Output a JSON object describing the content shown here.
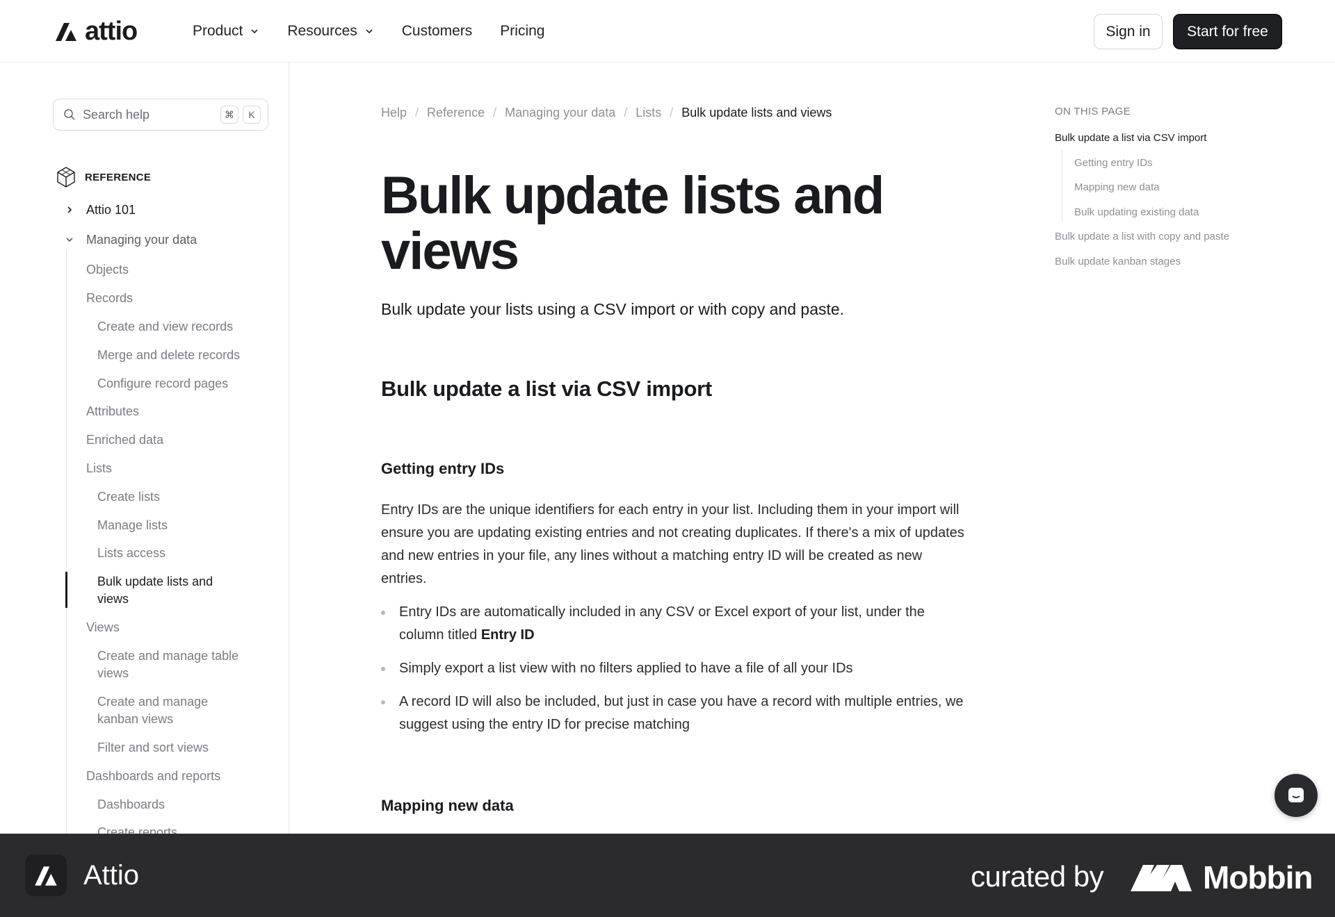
{
  "header": {
    "brand": "attio",
    "nav": [
      {
        "label": "Product",
        "dropdown": true
      },
      {
        "label": "Resources",
        "dropdown": true
      },
      {
        "label": "Customers",
        "dropdown": false
      },
      {
        "label": "Pricing",
        "dropdown": false
      }
    ],
    "signin_label": "Sign in",
    "start_label": "Start for free"
  },
  "sidebar": {
    "search_placeholder": "Search help",
    "kbd_cmd": "⌘",
    "kbd_k": "K",
    "section_label": "REFERENCE",
    "items": [
      {
        "label": "Attio 101"
      },
      {
        "label": "Managing your data"
      },
      {
        "label": "Objects"
      },
      {
        "label": "Records"
      },
      {
        "label": "Create and view records"
      },
      {
        "label": "Merge and delete records"
      },
      {
        "label": "Configure record pages"
      },
      {
        "label": "Attributes"
      },
      {
        "label": "Enriched data"
      },
      {
        "label": "Lists"
      },
      {
        "label": "Create lists"
      },
      {
        "label": "Manage lists"
      },
      {
        "label": "Lists access"
      },
      {
        "label": "Bulk update lists and views"
      },
      {
        "label": "Views"
      },
      {
        "label": "Create and manage table views"
      },
      {
        "label": "Create and manage kanban views"
      },
      {
        "label": "Filter and sort views"
      },
      {
        "label": "Dashboards and reports"
      },
      {
        "label": "Dashboards"
      },
      {
        "label": "Create reports"
      }
    ]
  },
  "breadcrumb": [
    "Help",
    "Reference",
    "Managing your data",
    "Lists",
    "Bulk update lists and views"
  ],
  "article": {
    "title": "Bulk update lists and views",
    "lead": "Bulk update your lists using a CSV import or with copy and paste.",
    "h2": "Bulk update a list via CSV import",
    "h3_1": "Getting entry IDs",
    "para": "Entry IDs are the unique identifiers for each entry in your list. Including them in your import will ensure you are updating existing entries and not creating duplicates. If there's a mix of updates and new entries in your file, any lines without a matching entry ID will be created as new entries.",
    "bullet1_pre": "Entry IDs are automatically included in any CSV or Excel export of your list, under the column titled ",
    "bullet1_bold": "Entry ID",
    "bullet2": "Simply export a list view with no filters applied to have a file of all your IDs",
    "bullet3": "A record ID will also be included, but just in case you have a record with multiple entries, we suggest using the entry ID for precise matching",
    "h3_2": "Mapping new data"
  },
  "toc": {
    "heading": "ON THIS PAGE",
    "items": [
      {
        "label": "Bulk update a list via CSV import",
        "active": true
      },
      {
        "label": "Getting entry IDs"
      },
      {
        "label": "Mapping new data"
      },
      {
        "label": "Bulk updating existing data"
      },
      {
        "label": "Bulk update a list with copy and paste"
      },
      {
        "label": "Bulk update kanban stages"
      }
    ]
  },
  "footer": {
    "app_name": "Attio",
    "curated_by": "curated by",
    "brand": "Mobbin"
  }
}
